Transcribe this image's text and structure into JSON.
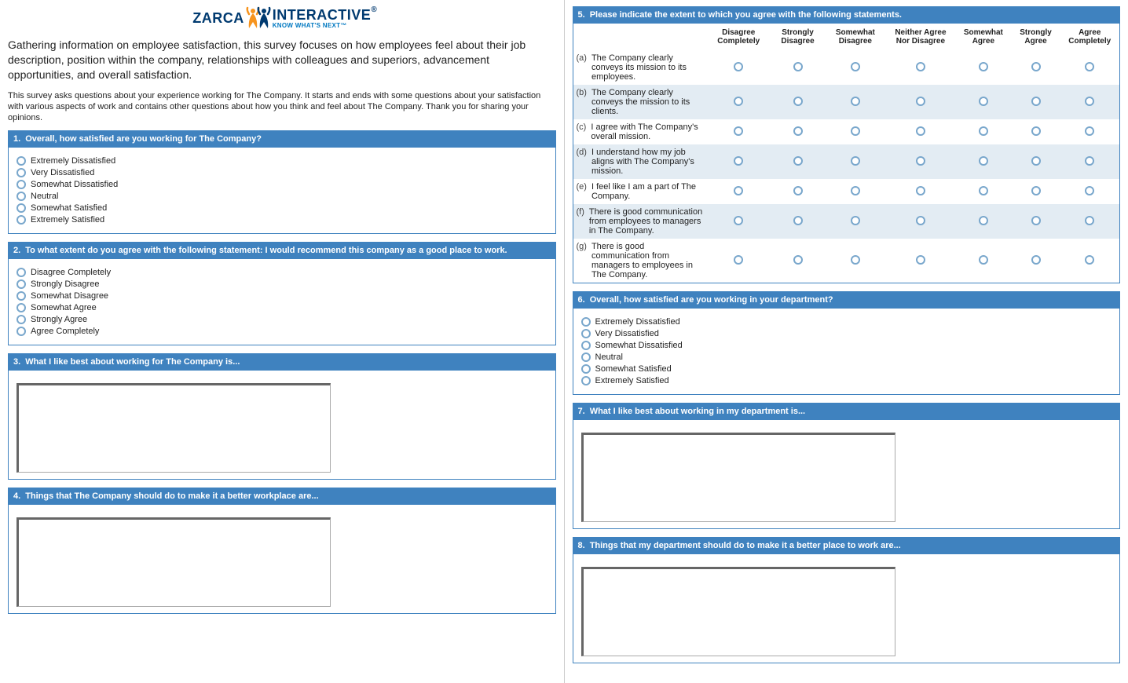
{
  "logo": {
    "brand_left": "ZARCA",
    "brand_right": "INTERACTIVE",
    "tagline": "KNOW WHAT'S NEXT™"
  },
  "intro": {
    "main": "Gathering information on employee satisfaction, this survey focuses on how employees feel about their job description, position within the company, relationships with colleagues and superiors, advancement opportunities, and overall satisfaction.",
    "sub": "This survey asks questions about your experience working for The Company. It starts and ends with some questions about your satisfaction with various aspects of work and contains other questions about how you think and feel about The Company. Thank you for sharing your opinions."
  },
  "q1": {
    "num": "1.",
    "title": "Overall, how satisfied are you working for The Company?",
    "options": [
      "Extremely Dissatisfied",
      "Very Dissatisfied",
      "Somewhat Dissatisfied",
      "Neutral",
      "Somewhat Satisfied",
      "Extremely Satisfied"
    ]
  },
  "q2": {
    "num": "2.",
    "title": "To what extent do you agree with the following statement: I would recommend this company as  a good place to work.",
    "options": [
      "Disagree Completely",
      "Strongly Disagree",
      "Somewhat Disagree",
      "Somewhat Agree",
      "Strongly Agree",
      "Agree Completely"
    ]
  },
  "q3": {
    "num": "3.",
    "title": "What I like best about working for The Company is..."
  },
  "q4": {
    "num": "4.",
    "title": "Things that The Company should do to make it a better workplace are..."
  },
  "q5": {
    "num": "5.",
    "title": "Please indicate the extent to which you agree with the following statements.",
    "cols": [
      "Disagree Completely",
      "Strongly Disagree",
      "Somewhat Disagree",
      "Neither Agree Nor Disagree",
      "Somewhat Agree",
      "Strongly Agree",
      "Agree Completely"
    ],
    "rows": [
      {
        "idx": "(a)",
        "text": "The Company clearly conveys its mission to its employees."
      },
      {
        "idx": "(b)",
        "text": "The Company clearly conveys the mission to its clients."
      },
      {
        "idx": "(c)",
        "text": "I agree with The Company's overall mission."
      },
      {
        "idx": "(d)",
        "text": "I understand how my job aligns with The Company's mission."
      },
      {
        "idx": "(e)",
        "text": "I feel like I am a part of The Company."
      },
      {
        "idx": "(f)",
        "text": "There is good communication from employees to managers in The Company."
      },
      {
        "idx": "(g)",
        "text": "There is good communication from managers to employees in The Company."
      }
    ]
  },
  "q6": {
    "num": "6.",
    "title": "Overall, how satisfied are you working in your department?",
    "options": [
      "Extremely Dissatisfied",
      "Very Dissatisfied",
      "Somewhat Dissatisfied",
      "Neutral",
      "Somewhat Satisfied",
      "Extremely Satisfied"
    ]
  },
  "q7": {
    "num": "7.",
    "title": "What I like best about working in my department is..."
  },
  "q8": {
    "num": "8.",
    "title": "Things that my department should do to make it a better place to work are..."
  }
}
